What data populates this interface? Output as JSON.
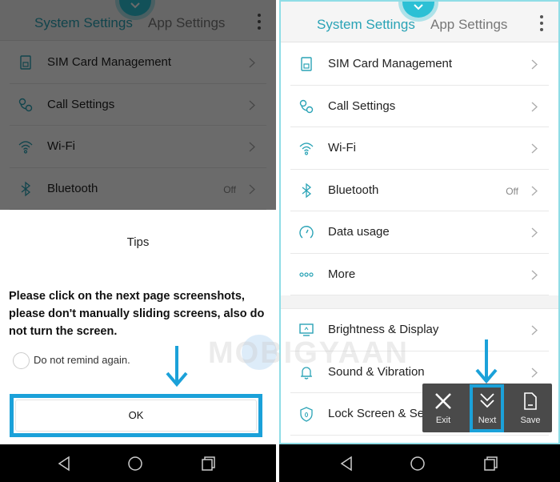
{
  "tabs": {
    "system": "System Settings",
    "app": "App Settings"
  },
  "colors": {
    "accent": "#2aa3b6",
    "highlight": "#1ba1d9"
  },
  "left": {
    "items": [
      {
        "icon": "sim-card-icon",
        "label": "SIM Card Management",
        "value": ""
      },
      {
        "icon": "phone-icon",
        "label": "Call Settings",
        "value": ""
      },
      {
        "icon": "wifi-icon",
        "label": "Wi-Fi",
        "value": ""
      },
      {
        "icon": "bluetooth-icon",
        "label": "Bluetooth",
        "value": "Off"
      }
    ],
    "dialog": {
      "title": "Tips",
      "message": "Please click on the next page screenshots, please don't manually sliding screens, also do not turn the screen.",
      "checkbox_label": "Do not remind again.",
      "ok_label": "OK"
    }
  },
  "right": {
    "items": [
      {
        "icon": "sim-card-icon",
        "label": "SIM Card Management",
        "value": ""
      },
      {
        "icon": "phone-icon",
        "label": "Call Settings",
        "value": ""
      },
      {
        "icon": "wifi-icon",
        "label": "Wi-Fi",
        "value": ""
      },
      {
        "icon": "bluetooth-icon",
        "label": "Bluetooth",
        "value": "Off"
      },
      {
        "icon": "data-usage-icon",
        "label": "Data usage",
        "value": ""
      },
      {
        "icon": "more-icon",
        "label": "More",
        "value": ""
      }
    ],
    "items2": [
      {
        "icon": "display-icon",
        "label": "Brightness & Display",
        "value": ""
      },
      {
        "icon": "bell-icon",
        "label": "Sound & Vibration",
        "value": ""
      },
      {
        "icon": "shield-icon",
        "label": "Lock Screen & Security",
        "value": ""
      }
    ],
    "toolbar": {
      "exit": "Exit",
      "next": "Next",
      "save": "Save"
    }
  },
  "watermark": "MOBIGYAAN"
}
